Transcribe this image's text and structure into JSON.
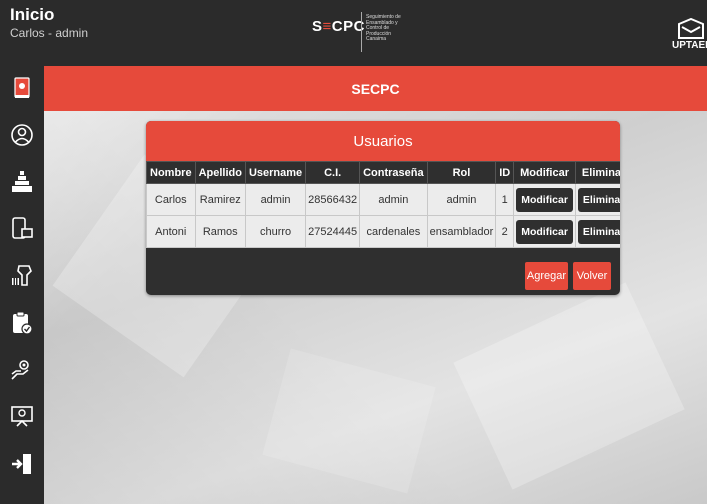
{
  "header": {
    "title": "Inicio",
    "subtitle": "Carlos - admin",
    "center_logo_mark_left": "S",
    "center_logo_mark_mid": "≡",
    "center_logo_mark_right": "CPC",
    "center_logo_tagline": "Seguimiento de Ensamblado y Control de Producción Canaima",
    "right_logo_text": "UPTAEB"
  },
  "banner": {
    "title": "SECPC"
  },
  "sidebar": {
    "items": [
      {
        "icon": "book-icon"
      },
      {
        "icon": "user-icon"
      },
      {
        "icon": "stats-icon"
      },
      {
        "icon": "devices-icon"
      },
      {
        "icon": "scanner-icon"
      },
      {
        "icon": "clipboard-check-icon"
      },
      {
        "icon": "hand-gear-icon"
      },
      {
        "icon": "presentation-icon"
      },
      {
        "icon": "exit-icon"
      }
    ]
  },
  "users_panel": {
    "title": "Usuarios",
    "columns": [
      "Nombre",
      "Apellido",
      "Username",
      "C.I.",
      "Contraseña",
      "Rol",
      "ID",
      "Modificar",
      "Eliminar"
    ],
    "rows": [
      {
        "nombre": "Carlos",
        "apellido": "Ramirez",
        "username": "admin",
        "ci": "28566432",
        "contrasena": "admin",
        "rol": "admin",
        "id": "1",
        "modificar": "Modificar",
        "eliminar": "Eliminar"
      },
      {
        "nombre": "Antoni",
        "apellido": "Ramos",
        "username": "churro",
        "ci": "27524445",
        "contrasena": "cardenales",
        "rol": "ensamblador",
        "id": "2",
        "modificar": "Modificar",
        "eliminar": "Eliminar"
      }
    ],
    "add_label": "Agregar",
    "back_label": "Volver"
  },
  "colors": {
    "accent": "#e64a3b",
    "dark": "#2b2b2b"
  }
}
